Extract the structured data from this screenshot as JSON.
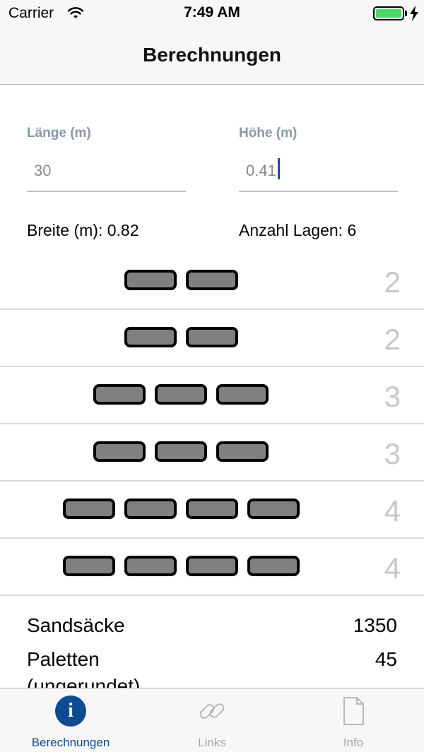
{
  "status_bar": {
    "carrier": "Carrier",
    "time": "7:49 AM",
    "battery_color": "#4cd964"
  },
  "nav": {
    "title": "Berechnungen"
  },
  "inputs": {
    "length": {
      "label": "Länge (m)",
      "value": "30"
    },
    "height": {
      "label": "Höhe (m)",
      "value": "0.41"
    }
  },
  "stats": {
    "width_text": "Breite (m): 0.82",
    "layers_text": "Anzahl Lagen: 6"
  },
  "layers": [
    {
      "count": "2",
      "bags": 2
    },
    {
      "count": "2",
      "bags": 2
    },
    {
      "count": "3",
      "bags": 3
    },
    {
      "count": "3",
      "bags": 3
    },
    {
      "count": "4",
      "bags": 4
    },
    {
      "count": "4",
      "bags": 4
    }
  ],
  "summary": {
    "sandbags_label": "Sandsäcke",
    "sandbags_value": "1350",
    "pallets_label": "Paletten",
    "pallets_value": "45",
    "pallets_sub": "(ungerundet)"
  },
  "tabs": [
    {
      "label": "Berechnungen",
      "icon": "info-icon",
      "active": true
    },
    {
      "label": "Links",
      "icon": "link-icon",
      "active": false
    },
    {
      "label": "Info",
      "icon": "document-icon",
      "active": false
    }
  ],
  "colors": {
    "accent": "#0d4c92",
    "bag_fill": "#808080",
    "row_count": "#c7c7c7"
  }
}
